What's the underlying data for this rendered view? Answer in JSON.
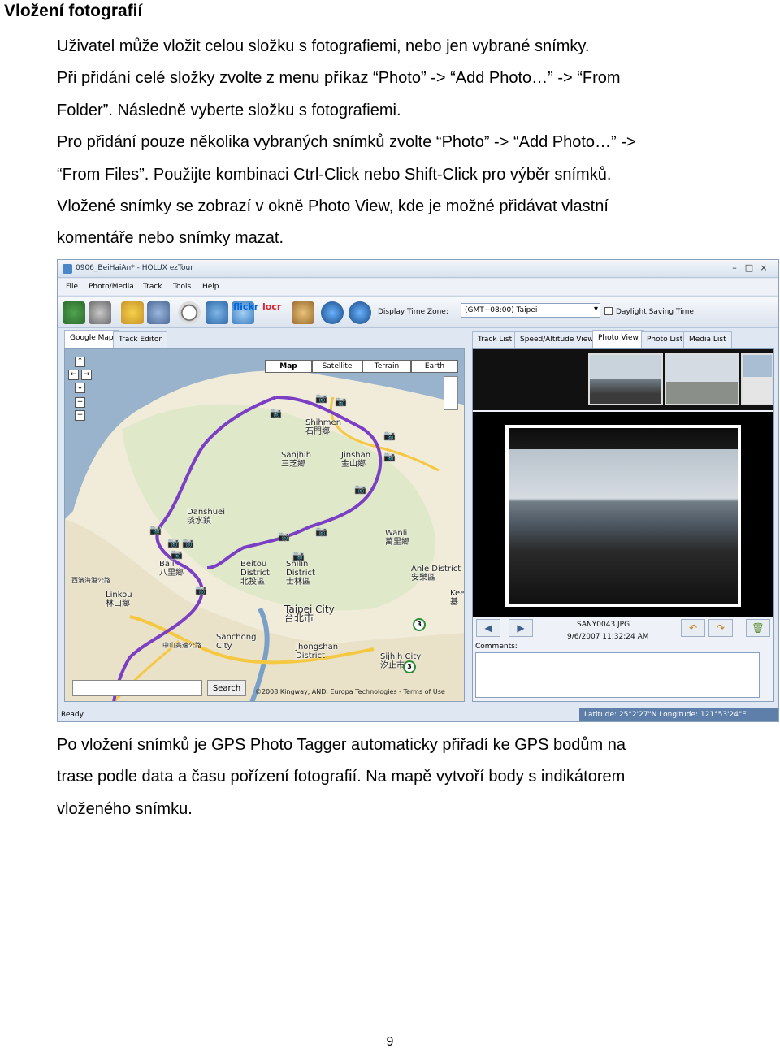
{
  "heading": "Vložení fotografií",
  "intro_lines": [
    "Uživatel může vložit celou složku s fotografiemi, nebo jen vybrané snímky.",
    "Při přidání celé složky zvolte z menu příkaz “Photo” -> “Add Photo…” -> “From",
    "Folder”. Následně vyberte složku s fotografiemi.",
    "Pro přidání pouze několika vybraných snímků zvolte “Photo” -> “Add Photo…” ->",
    "“From Files”. Použijte kombinaci Ctrl-Click nebo Shift-Click pro výběr snímků.",
    "Vložené snímky se zobrazí v okně Photo View, kde je možné přidávat vlastní",
    "komentáře nebo snímky mazat."
  ],
  "outro_lines": [
    "Po vložení snímků je GPS Photo Tagger automaticky přiřadí ke GPS bodům na",
    "trase podle data a času pořízení fotografií. Na mapě vytvoří body s indikátorem",
    "vloženého snímku."
  ],
  "page_number": "9",
  "screenshot": {
    "window_title": "0906_BeiHaiAn* - HOLUX ezTour",
    "menu": [
      "File",
      "Photo/Media",
      "Track",
      "Tools",
      "Help"
    ],
    "toolbar": {
      "icons": [
        "save-icon",
        "import-device-icon",
        "edit-icon",
        "photo-folder-icon",
        "clock-icon",
        "time-sync-icon",
        "share-icon",
        "flickr-icon",
        "locr-icon",
        "photo-album-icon",
        "google-earth-icon",
        "kmz-icon"
      ],
      "flickr_label": "flickr",
      "locr_label": "locr",
      "display_time_zone_label": "Display Time Zone:",
      "time_zone_value": "(GMT+08:00) Taipei",
      "dst_label": "Daylight Saving Time"
    },
    "left_tabs": [
      "Google Map",
      "Track Editor"
    ],
    "right_tabs": [
      "Track List",
      "Speed/Altitude View",
      "Photo View",
      "Photo List",
      "Media List"
    ],
    "map": {
      "types": [
        "Map",
        "Satellite",
        "Terrain",
        "Earth"
      ],
      "places": [
        "Shihmen",
        "石門鄉",
        "Sanjhih",
        "三芝鄉",
        "Jinshan",
        "金山鄉",
        "Danshuei",
        "淡水鎮",
        "Wanli",
        "萬里鄉",
        "Bali",
        "八里鄉",
        "Beitou",
        "District",
        "北投區",
        "Shilin",
        "District",
        "士林區",
        "Anle District",
        "安樂區",
        "Taipei City",
        "台北市",
        "Sanchong",
        "City",
        "Jhongshan",
        "District",
        "Sijhih City",
        "汐止市",
        "Linkou",
        "林口鄉",
        "西濱海港公路",
        "中山高速公路",
        "Kee",
        "基"
      ],
      "route_badges": [
        "3",
        "3"
      ],
      "search_button": "Search",
      "copyright": "©2008 Kingway, AND, Europa Technologies - Terms of Use"
    },
    "photo_view": {
      "filename": "SANY0043.JPG",
      "datetime": "9/6/2007 11:32:24 AM",
      "comments_label": "Comments:"
    },
    "status": {
      "ready": "Ready",
      "coords": "Latitude: 25°2'27\"N Longitude: 121°53'24\"E"
    }
  }
}
